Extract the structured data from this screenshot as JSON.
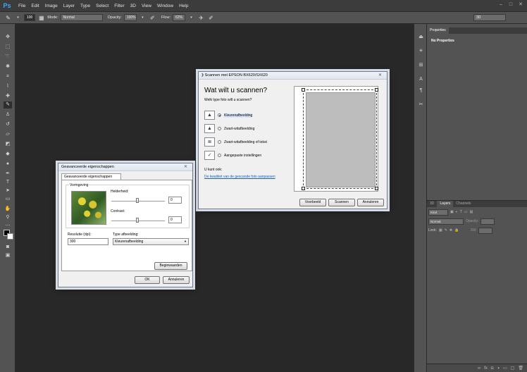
{
  "app": {
    "logo": "Ps"
  },
  "menu": [
    "File",
    "Edit",
    "Image",
    "Layer",
    "Type",
    "Select",
    "Filter",
    "3D",
    "View",
    "Window",
    "Help"
  ],
  "options_bar": {
    "brush_size": "100",
    "mode_label": "Mode:",
    "mode_value": "Normal",
    "opacity_label": "Opacity:",
    "opacity_value": "100%",
    "flow_label": "Flow:",
    "flow_value": "62%",
    "workspace": "3D"
  },
  "panels": {
    "properties_tab": "Properties",
    "properties_body": "No Properties",
    "layers_tabs": [
      "3D",
      "Layers",
      "Channels"
    ],
    "kind_label": "Kind",
    "blend_mode": "Normal",
    "opacity_label": "Opacity:",
    "lock_label": "Lock:",
    "fill_label": "Fill:"
  },
  "scan_dialog": {
    "title": "Scannen met EPSON BX620/SX620",
    "heading": "Wat wilt u scannen?",
    "subheading": "Welk type foto wilt u scannen?",
    "options": [
      {
        "label": "Kleurenafbeelding",
        "selected": true
      },
      {
        "label": "Zwart-witafbeelding",
        "selected": false
      },
      {
        "label": "Zwart-witafbeelding of tekst",
        "selected": false
      },
      {
        "label": "Aangepaste instellingen",
        "selected": false
      }
    ],
    "can_also": "U kunt ook:",
    "adjust_link": "De kwaliteit van de gescande foto aanpassen",
    "buttons": {
      "preview": "Voorbeeld",
      "scan": "Scannen",
      "cancel": "Annuleren"
    }
  },
  "advanced_dialog": {
    "title": "Geavanceerde eigenschappen",
    "tab": "Geavanceerde eigenschappen",
    "appearance_group": "Vormgeving",
    "brightness_label": "Helderheid:",
    "brightness_value": "0",
    "contrast_label": "Contrast:",
    "contrast_value": "0",
    "resolution_label": "Resolutie (dpi):",
    "resolution_value": "300",
    "type_label": "Type afbeelding:",
    "type_value": "Kleurenafbeelding",
    "reset_button": "Beginwaarden",
    "ok_button": "OK",
    "cancel_button": "Annuleren"
  }
}
